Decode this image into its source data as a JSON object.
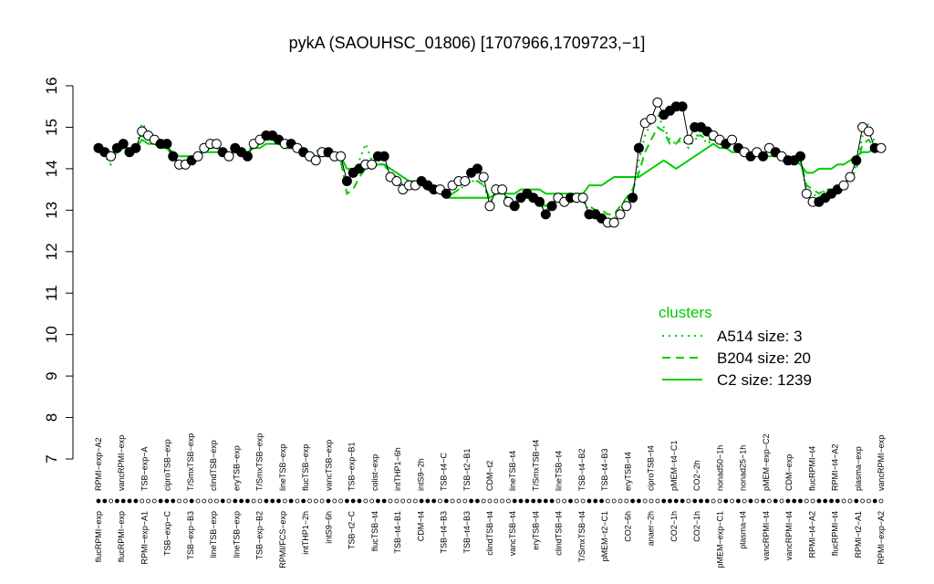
{
  "title": "pykA (SAOUHSC_01806) [1707966,1709723,−1]",
  "colors": {
    "cluster_line": "#00cc00",
    "points_stroke": "#000000",
    "axis": "#000000"
  },
  "chart_data": {
    "type": "line",
    "ylim": [
      7,
      16
    ],
    "yticks": [
      7,
      8,
      9,
      10,
      11,
      12,
      13,
      14,
      15,
      16
    ],
    "grid": false,
    "legend_position": "right",
    "top_labels": [
      "RPMI−exp−A2",
      "vancRPMI−exp",
      "TSB−exp−A",
      "ciproTSB−exp",
      "T/SmxTSB−exp",
      "clindTSB−exp",
      "eryTSB−exp",
      "T/SmxTSB−exp",
      "lineTSB−exp",
      "flucTSB−exp",
      "vancTSB−exp",
      "TSB−exp−B1",
      "colist−exp",
      "intTHP1−6h",
      "intS9−2h",
      "TSB−t4−C",
      "TSB−t2−B1",
      "CDM−t2",
      "lineTSB−t4",
      "T/SmxTSB−t4",
      "lineTSB−t4",
      "TSB−t4−B2",
      "TSB−t4−B3",
      "eryTSB−t4",
      "ciproTSB−t4",
      "pMEM−t4−C1",
      "CO2−2h",
      "nonad50−1h",
      "nonad25−1h",
      "pMEM−exp−C2",
      "CDM−exp",
      "flucRPMI−t4",
      "RPMI−t4−A2",
      "plasma−exp",
      "vancRPMI−exp"
    ],
    "bottom_labels": [
      "flucRPMI−exp",
      "flucRPMI−exp",
      "RPMI−exp−A1",
      "TSB−exp−C",
      "TSB−exp−B3",
      "lineTSB−exp",
      "lineTSB−exp",
      "TSB−exp−B2",
      "RPMI/FCS−exp",
      "intTHP1−2h",
      "intS9−6h",
      "TSB−t2−C",
      "flucTSB−t4",
      "TSB−t4−B1",
      "CDM−t4",
      "TSB−t4−B3",
      "TSB−t4−B3",
      "clindTSB−t4",
      "vancTSB−t4",
      "eryTSB−t4",
      "clindTSB−t4",
      "T/SmxTSB−t4",
      "pMEM−t2−C1",
      "CO2−6h",
      "anaer−2h",
      "CO2−1h",
      "CO2−1h",
      "pMEM−exp−C1",
      "plasma−t4",
      "vancRPMI−t4",
      "vancRPMI−t4",
      "RPMI−t4−A2",
      "flucRPMI−t4",
      "RPMI−t2−A1",
      "RPMI−exp−A2"
    ],
    "series": [
      {
        "name": "expression",
        "values": [
          14.5,
          14.4,
          14.3,
          14.5,
          14.6,
          14.4,
          14.5,
          14.9,
          14.8,
          14.7,
          14.6,
          14.6,
          14.3,
          14.1,
          14.1,
          14.2,
          14.3,
          14.5,
          14.6,
          14.6,
          14.4,
          14.3,
          14.5,
          14.4,
          14.3,
          14.6,
          14.7,
          14.8,
          14.8,
          14.7,
          14.6,
          14.6,
          14.5,
          14.4,
          14.3,
          14.2,
          14.4,
          14.4,
          14.3,
          14.3,
          13.7,
          13.9,
          14.0,
          14.1,
          14.1,
          14.3,
          14.3,
          13.8,
          13.7,
          13.5,
          13.6,
          13.6,
          13.7,
          13.6,
          13.5,
          13.5,
          13.4,
          13.6,
          13.7,
          13.7,
          13.9,
          14.0,
          13.8,
          13.1,
          13.5,
          13.5,
          13.2,
          13.1,
          13.3,
          13.4,
          13.3,
          13.2,
          12.9,
          13.1,
          13.3,
          13.2,
          13.3,
          13.3,
          13.3,
          12.9,
          12.9,
          12.8,
          12.7,
          12.7,
          12.9,
          13.1,
          13.3,
          14.5,
          15.1,
          15.2,
          15.6,
          15.3,
          15.4,
          15.5,
          15.5,
          14.7,
          15.0,
          15.0,
          14.9,
          14.8,
          14.7,
          14.6,
          14.7,
          14.5,
          14.4,
          14.3,
          14.4,
          14.3,
          14.5,
          14.4,
          14.3,
          14.2,
          14.2,
          14.3,
          13.4,
          13.2,
          13.2,
          13.3,
          13.4,
          13.5,
          13.6,
          13.8,
          14.2,
          15.0,
          14.9,
          14.5,
          14.5
        ],
        "filled": [
          1,
          1,
          0,
          1,
          1,
          1,
          1,
          0,
          0,
          0,
          1,
          1,
          1,
          0,
          0,
          1,
          0,
          0,
          0,
          0,
          1,
          0,
          1,
          1,
          1,
          0,
          0,
          1,
          1,
          1,
          0,
          1,
          0,
          1,
          0,
          0,
          0,
          1,
          0,
          0,
          1,
          1,
          1,
          0,
          0,
          1,
          1,
          0,
          0,
          0,
          0,
          0,
          1,
          1,
          1,
          0,
          1,
          0,
          0,
          0,
          1,
          1,
          0,
          0,
          0,
          0,
          0,
          1,
          1,
          1,
          1,
          1,
          1,
          1,
          0,
          0,
          1,
          0,
          0,
          1,
          1,
          1,
          0,
          0,
          0,
          0,
          1,
          1,
          0,
          0,
          0,
          1,
          1,
          1,
          1,
          0,
          1,
          1,
          1,
          0,
          0,
          1,
          0,
          1,
          0,
          1,
          0,
          1,
          0,
          1,
          0,
          1,
          1,
          1,
          0,
          0,
          1,
          1,
          1,
          1,
          0,
          0,
          1,
          0,
          0,
          1,
          0
        ]
      },
      {
        "name": "C2 size: 1239",
        "style": "solid",
        "values": [
          14.4,
          14.4,
          14.4,
          14.4,
          14.5,
          14.5,
          14.5,
          14.7,
          14.6,
          14.6,
          14.5,
          14.5,
          14.4,
          14.3,
          14.3,
          14.3,
          14.3,
          14.4,
          14.4,
          14.4,
          14.4,
          14.3,
          14.4,
          14.4,
          14.4,
          14.5,
          14.5,
          14.6,
          14.6,
          14.6,
          14.5,
          14.5,
          14.5,
          14.4,
          14.4,
          14.3,
          14.3,
          14.3,
          14.3,
          14.3,
          14.0,
          14.0,
          14.1,
          14.1,
          14.1,
          14.1,
          14.1,
          14.0,
          13.9,
          13.8,
          13.7,
          13.7,
          13.6,
          13.5,
          13.5,
          13.4,
          13.3,
          13.3,
          13.3,
          13.3,
          13.3,
          13.3,
          13.3,
          13.3,
          13.4,
          13.4,
          13.4,
          13.4,
          13.5,
          13.5,
          13.5,
          13.5,
          13.4,
          13.4,
          13.4,
          13.4,
          13.4,
          13.4,
          13.4,
          13.6,
          13.6,
          13.6,
          13.7,
          13.8,
          13.8,
          13.8,
          13.8,
          13.8,
          13.9,
          14.0,
          14.1,
          14.2,
          14.1,
          14.0,
          14.1,
          14.2,
          14.3,
          14.4,
          14.5,
          14.6,
          14.5,
          14.5,
          14.4,
          14.4,
          14.4,
          14.3,
          14.3,
          14.3,
          14.3,
          14.3,
          14.3,
          14.3,
          14.2,
          14.1,
          13.9,
          13.9,
          14.0,
          14.0,
          14.0,
          14.1,
          14.1,
          14.2,
          14.3,
          14.4,
          14.4,
          14.5,
          14.5
        ]
      },
      {
        "name": "B204 size: 20",
        "style": "dashed",
        "values": [
          14.5,
          14.4,
          14.3,
          14.4,
          14.5,
          14.5,
          14.5,
          14.8,
          14.7,
          14.6,
          14.5,
          14.5,
          14.3,
          14.1,
          14.1,
          14.2,
          14.3,
          14.4,
          14.5,
          14.5,
          14.4,
          14.3,
          14.4,
          14.4,
          14.4,
          14.5,
          14.6,
          14.7,
          14.7,
          14.6,
          14.5,
          14.5,
          14.5,
          14.4,
          14.3,
          14.3,
          14.3,
          14.3,
          14.3,
          14.2,
          13.4,
          13.5,
          13.8,
          14.0,
          14.0,
          14.1,
          14.1,
          13.9,
          13.8,
          13.6,
          13.6,
          13.6,
          13.6,
          13.5,
          13.5,
          13.4,
          13.4,
          13.4,
          13.5,
          13.6,
          13.7,
          13.7,
          13.6,
          13.3,
          13.4,
          13.4,
          13.3,
          13.2,
          13.3,
          13.3,
          13.3,
          13.2,
          13.1,
          13.2,
          13.3,
          13.3,
          13.3,
          13.3,
          13.2,
          13.1,
          13.0,
          13.0,
          12.9,
          12.9,
          13.1,
          13.3,
          13.5,
          13.9,
          14.4,
          14.7,
          15.0,
          14.9,
          14.6,
          14.6,
          14.8,
          14.7,
          14.8,
          14.8,
          14.7,
          14.7,
          14.6,
          14.6,
          14.6,
          14.5,
          14.4,
          14.4,
          14.4,
          14.3,
          14.4,
          14.4,
          14.3,
          14.2,
          14.2,
          14.2,
          13.6,
          13.5,
          13.4,
          13.5,
          13.5,
          13.5,
          13.6,
          13.7,
          14.0,
          14.6,
          14.7,
          14.5,
          14.5
        ]
      },
      {
        "name": "A514 size: 3",
        "style": "dotted",
        "values": [
          14.5,
          14.3,
          14.1,
          14.4,
          14.5,
          14.5,
          14.5,
          15.1,
          14.9,
          14.7,
          14.6,
          14.5,
          14.3,
          14.1,
          14.1,
          14.2,
          14.3,
          14.4,
          14.5,
          14.5,
          14.4,
          14.3,
          14.4,
          14.4,
          14.4,
          14.6,
          14.7,
          14.7,
          14.7,
          14.6,
          14.5,
          14.5,
          14.5,
          14.4,
          14.2,
          14.4,
          14.5,
          14.4,
          14.3,
          14.2,
          13.6,
          13.9,
          14.2,
          14.6,
          14.2,
          14.1,
          14.1,
          13.8,
          13.7,
          13.5,
          13.5,
          13.6,
          13.6,
          13.5,
          13.4,
          13.4,
          13.3,
          13.4,
          13.5,
          13.6,
          13.7,
          13.7,
          13.6,
          13.2,
          13.4,
          13.4,
          13.2,
          13.2,
          13.3,
          13.3,
          13.3,
          13.2,
          13.0,
          13.1,
          13.2,
          13.2,
          13.2,
          13.2,
          13.2,
          13.0,
          12.9,
          12.9,
          12.8,
          12.8,
          13.0,
          13.2,
          13.4,
          14.2,
          14.8,
          15.1,
          15.3,
          15.0,
          14.7,
          14.6,
          14.7,
          14.5,
          14.7,
          14.8,
          14.6,
          14.7,
          14.6,
          14.5,
          14.6,
          14.4,
          14.4,
          14.3,
          14.4,
          14.3,
          14.4,
          14.3,
          14.3,
          14.2,
          14.2,
          14.2,
          13.5,
          13.4,
          13.3,
          13.5,
          13.5,
          13.6,
          13.6,
          13.7,
          14.1,
          14.8,
          15.1,
          14.6,
          14.5
        ]
      }
    ],
    "legend": {
      "title": "clusters",
      "entries": [
        {
          "label": "A514 size: 3",
          "style": "dotted"
        },
        {
          "label": "B204 size: 20",
          "style": "dashed"
        },
        {
          "label": "C2 size: 1239",
          "style": "solid"
        }
      ]
    }
  }
}
